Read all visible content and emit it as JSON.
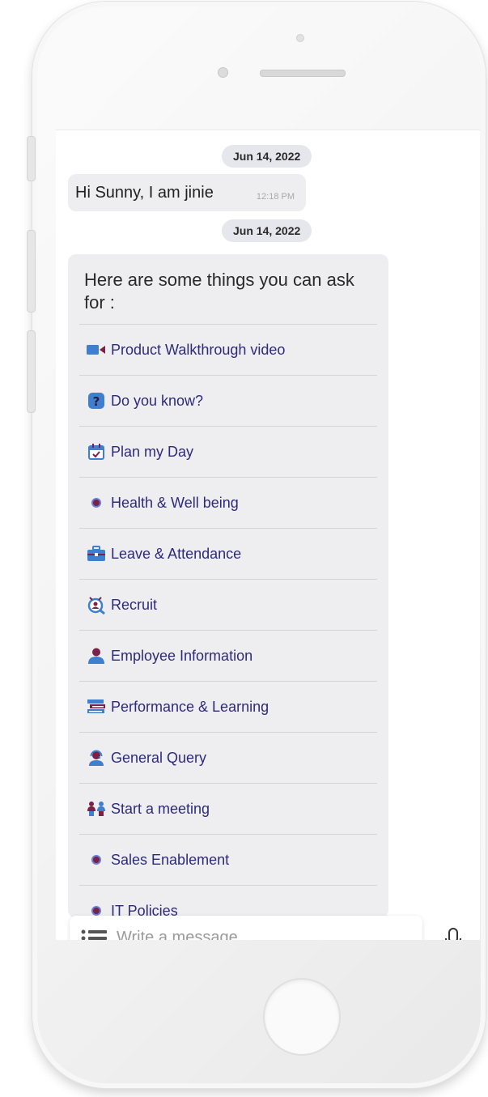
{
  "chat": {
    "date_chip_1": "Jun 14, 2022",
    "greeting": {
      "text": "Hi Sunny, I am jinie",
      "time": "12:18 PM"
    },
    "date_chip_2": "Jun 14, 2022",
    "menu": {
      "intro": "Here are some things you can ask for :",
      "items": [
        {
          "label": "Product Walkthrough video",
          "icon": "video-camera-icon"
        },
        {
          "label": "Do you know?",
          "icon": "question-mark-icon"
        },
        {
          "label": "Plan my Day",
          "icon": "calendar-check-icon"
        },
        {
          "label": "Health & Well being",
          "icon": "bullet-dot-icon"
        },
        {
          "label": "Leave & Attendance",
          "icon": "briefcase-icon"
        },
        {
          "label": "Recruit",
          "icon": "recruit-search-icon"
        },
        {
          "label": "Employee Information",
          "icon": "person-icon"
        },
        {
          "label": "Performance & Learning",
          "icon": "books-icon"
        },
        {
          "label": "General Query",
          "icon": "support-agent-icon"
        },
        {
          "label": "Start a meeting",
          "icon": "meeting-icon"
        },
        {
          "label": "Sales Enablement",
          "icon": "bullet-dot-icon"
        },
        {
          "label": "IT Policies",
          "icon": "bullet-dot-icon"
        }
      ]
    }
  },
  "composer": {
    "placeholder": "Write a message...",
    "menu_icon": "list-menu-icon",
    "mic_icon": "microphone-icon"
  },
  "colors": {
    "menu_text": "#2e2a7a",
    "bubble_bg": "#eeeef1",
    "chip_bg": "#e6e7ec",
    "icon_blue": "#3f7fcf",
    "icon_maroon": "#7a2147"
  }
}
